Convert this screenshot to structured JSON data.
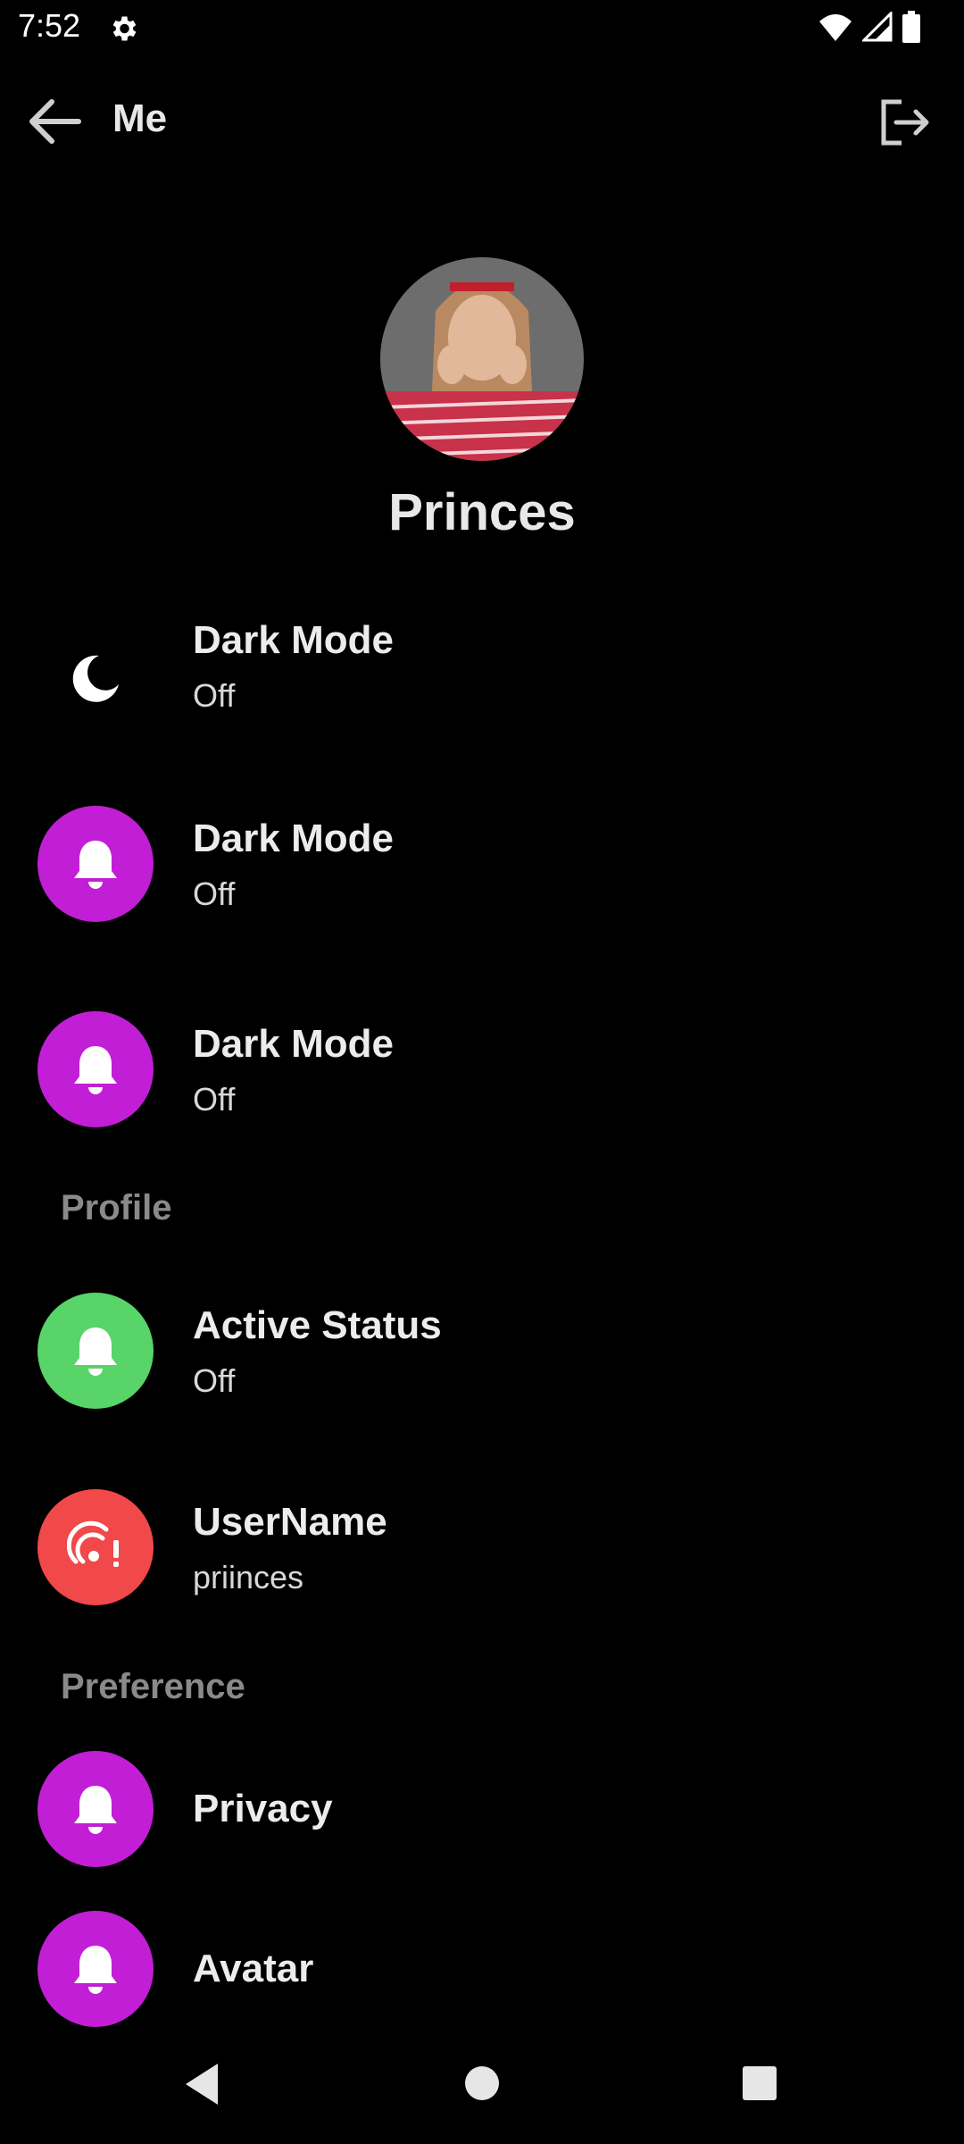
{
  "status_bar": {
    "time": "7:52"
  },
  "app_bar": {
    "title": "Me",
    "back_icon": "arrow-back-icon",
    "logout_icon": "logout-icon"
  },
  "profile": {
    "name": "Princes",
    "avatar_icon": "profile-photo"
  },
  "settings": {
    "dark_mode_1": {
      "title": "Dark Mode",
      "value": "Off",
      "icon": "moon-icon"
    },
    "dark_mode_2": {
      "title": "Dark Mode",
      "value": "Off",
      "icon": "bell-icon"
    },
    "dark_mode_3": {
      "title": "Dark Mode",
      "value": "Off",
      "icon": "bell-icon"
    }
  },
  "sections": {
    "profile": {
      "header": "Profile",
      "active_status": {
        "title": "Active Status",
        "value": "Off",
        "icon": "bell-icon"
      },
      "username": {
        "title": "UserName",
        "value": "priinces",
        "icon": "broadcast-alert-icon"
      }
    },
    "preference": {
      "header": "Preference",
      "privacy": {
        "title": "Privacy",
        "icon": "bell-icon"
      },
      "avatar": {
        "title": "Avatar",
        "icon": "bell-icon"
      }
    }
  },
  "colors": {
    "purple": "#c21ed6",
    "green": "#58d468",
    "red": "#f1484a",
    "background": "#000000",
    "section_header": "#8a8a8a"
  }
}
